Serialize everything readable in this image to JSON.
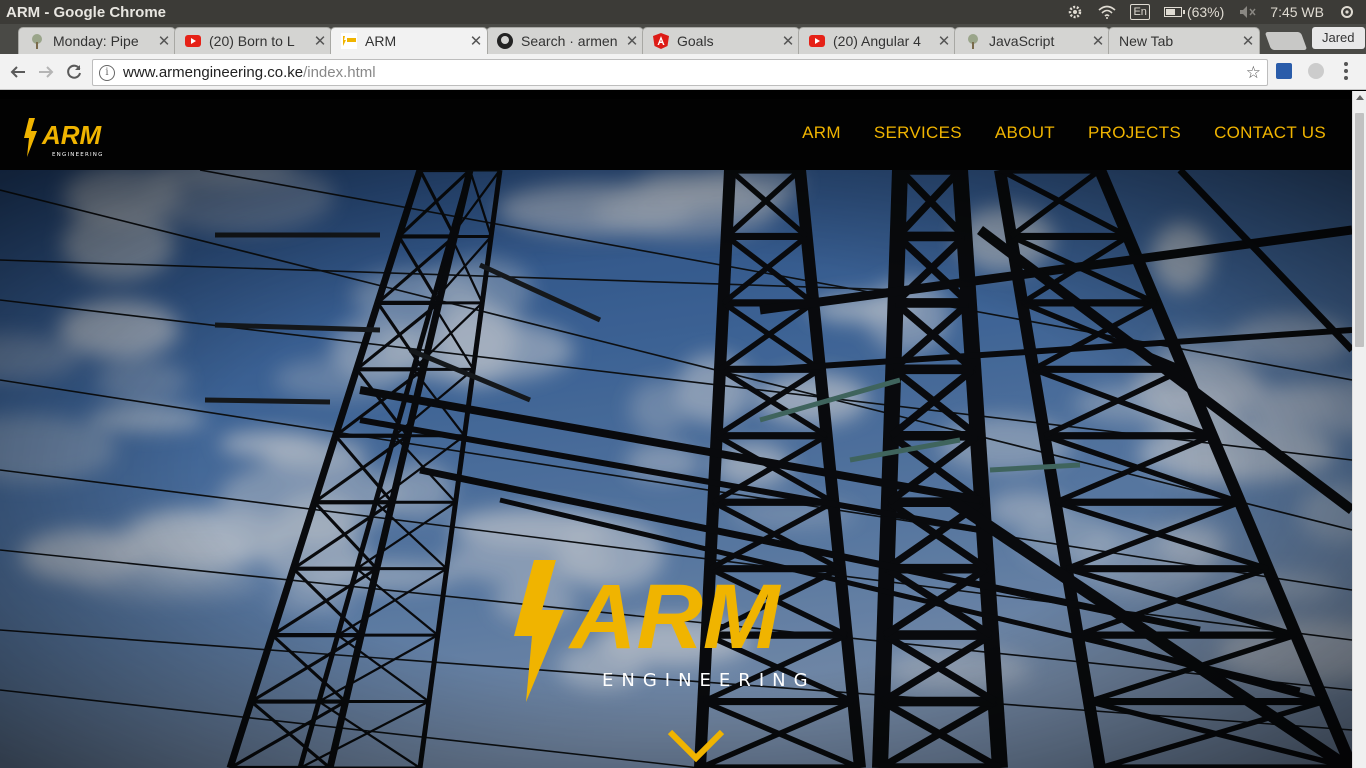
{
  "os": {
    "window_title": "ARM - Google Chrome",
    "keyboard_layout": "En",
    "battery": "(63%)",
    "battery_fraction": 0.63,
    "clock": "7:45 WB",
    "user": "Jared"
  },
  "tabs": [
    {
      "title": "Monday: Pipe",
      "favicon": "tree-icon",
      "active": false
    },
    {
      "title": "(20) Born to L",
      "favicon": "youtube-icon",
      "active": false
    },
    {
      "title": "ARM",
      "favicon": "arm-favicon",
      "active": true
    },
    {
      "title": "Search · armen",
      "favicon": "github-icon",
      "active": false
    },
    {
      "title": "Goals",
      "favicon": "angular-icon",
      "active": false
    },
    {
      "title": "(20) Angular 4",
      "favicon": "youtube-icon",
      "active": false
    },
    {
      "title": "JavaScript",
      "favicon": "tree-icon",
      "active": false
    },
    {
      "title": "New Tab",
      "favicon": "",
      "active": false
    }
  ],
  "profile_button": "Jared",
  "address_bar": {
    "host": "www.armengineering.co.ke",
    "path": "/index.html"
  },
  "site": {
    "nav_links": [
      "ARM",
      "SERVICES",
      "ABOUT",
      "PROJECTS",
      "CONTACT US"
    ],
    "logo_text": "ARM",
    "logo_subtext": "ENGINEERING",
    "hero_logo_text": "ARM",
    "hero_logo_subtext": "ENGINEERING"
  },
  "colors": {
    "brand_yellow": "#f0b400",
    "nav_bg": "#020202"
  }
}
